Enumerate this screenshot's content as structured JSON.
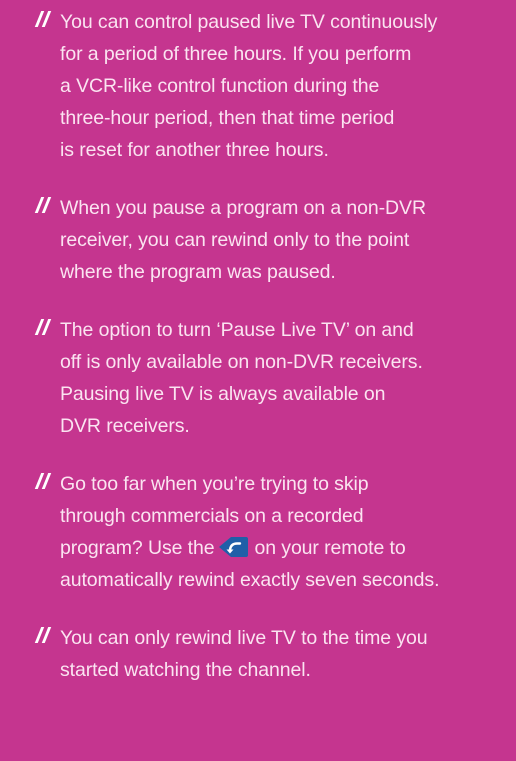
{
  "tips": [
    {
      "lines": [
        "You can control paused live TV continuously",
        "for a period of three hours. If you perform",
        "a VCR-like control function during the",
        "three-hour period, then that time period",
        "is reset for another three hours."
      ]
    },
    {
      "lines": [
        "When you pause a program on a non-DVR",
        "receiver, you can rewind only to the point",
        "where the program was paused."
      ]
    },
    {
      "lines": [
        "The option to turn ‘Pause Live TV’ on and",
        "off is only available on non-DVR receivers.",
        "Pausing live TV is always available on",
        "DVR receivers."
      ]
    },
    {
      "lines": [
        "Go too far when you’re trying to skip",
        "through commercials on a recorded"
      ],
      "icon_line_before": "program? Use the",
      "icon_line_after": "on your remote to",
      "after_lines": [
        "automatically rewind exactly seven seconds."
      ],
      "icon": "skip-back-button-icon",
      "icon_color": "#1f5fa8"
    },
    {
      "lines": [
        "You can only rewind live TV to the time you",
        "started watching the channel."
      ]
    }
  ],
  "colors": {
    "background": "#c5358f",
    "text": "#fbe4f1",
    "marker": "#ffffff"
  }
}
